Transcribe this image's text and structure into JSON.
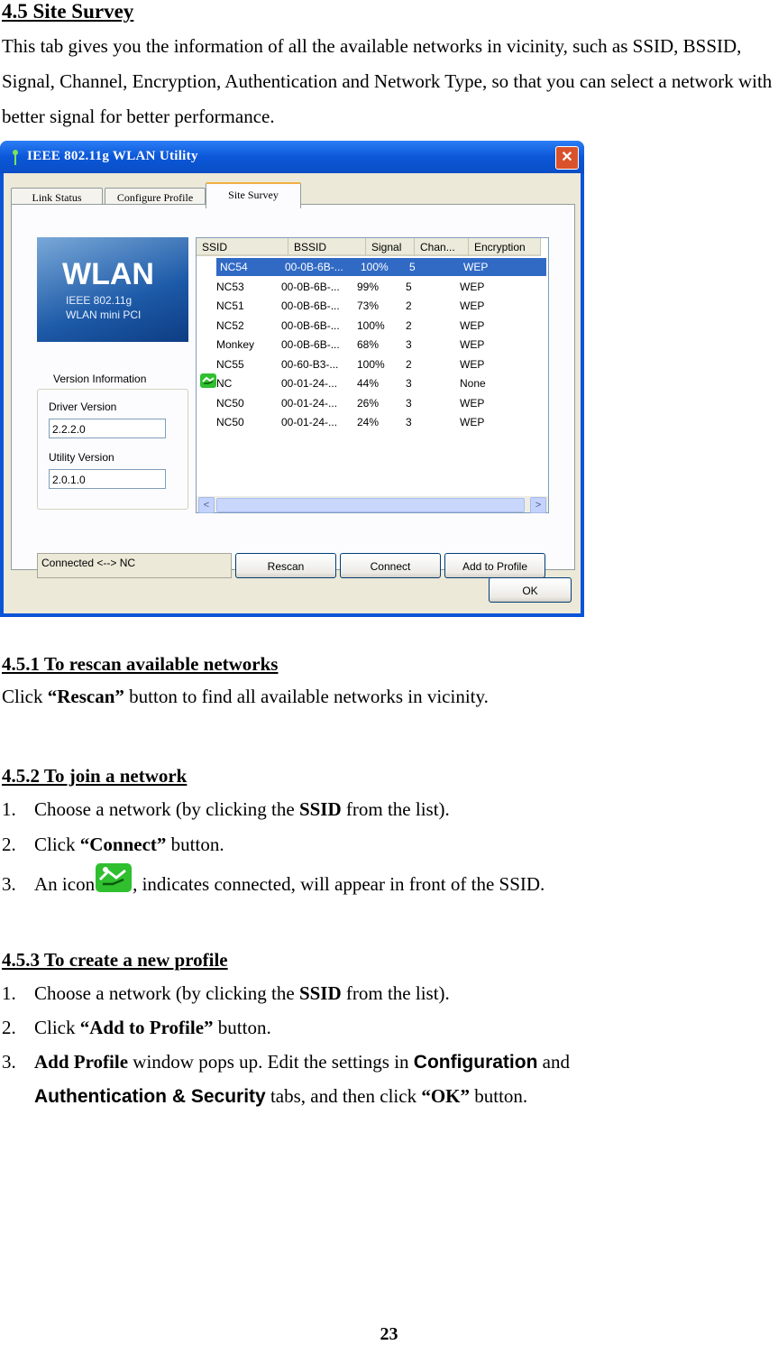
{
  "section": {
    "title": "4.5 Site Survey",
    "intro": "This tab gives you the information of all the available networks in vicinity, such as SSID, BSSID, Signal, Channel, Encryption, Authentication and Network Type, so that you can select a network with better signal for better performance."
  },
  "window": {
    "title": "IEEE 802.11g WLAN Utility",
    "close_glyph": "✕",
    "tabs": [
      "Link Status",
      "Configure Profile",
      "Site Survey"
    ],
    "logo": {
      "big": "WLAN",
      "line1": "IEEE 802.11g",
      "line2": "WLAN mini PCI"
    },
    "version_group": "Version Information",
    "driver_label": "Driver Version",
    "driver_value": "2.2.2.0",
    "utility_label": "Utility Version",
    "utility_value": "2.0.1.0",
    "columns": [
      "SSID",
      "BSSID",
      "Signal",
      "Chan...",
      "Encryption"
    ],
    "rows": [
      {
        "ssid": "NC54",
        "bssid": "00-0B-6B-...",
        "signal": "100%",
        "chan": "5",
        "enc": "WEP"
      },
      {
        "ssid": "NC53",
        "bssid": "00-0B-6B-...",
        "signal": "99%",
        "chan": "5",
        "enc": "WEP"
      },
      {
        "ssid": "NC51",
        "bssid": "00-0B-6B-...",
        "signal": "73%",
        "chan": "2",
        "enc": "WEP"
      },
      {
        "ssid": "NC52",
        "bssid": "00-0B-6B-...",
        "signal": "100%",
        "chan": "2",
        "enc": "WEP"
      },
      {
        "ssid": "Monkey",
        "bssid": "00-0B-6B-...",
        "signal": "68%",
        "chan": "3",
        "enc": "WEP"
      },
      {
        "ssid": "NC55",
        "bssid": "00-60-B3-...",
        "signal": "100%",
        "chan": "2",
        "enc": "WEP"
      },
      {
        "ssid": "NC",
        "bssid": "00-01-24-...",
        "signal": "44%",
        "chan": "3",
        "enc": "None"
      },
      {
        "ssid": "NC50",
        "bssid": "00-01-24-...",
        "signal": "26%",
        "chan": "3",
        "enc": "WEP"
      },
      {
        "ssid": "NC50",
        "bssid": "00-01-24-...",
        "signal": "24%",
        "chan": "3",
        "enc": "WEP"
      }
    ],
    "status": "Connected <--> NC",
    "rescan": "Rescan",
    "connect": "Connect",
    "add_to_profile": "Add to Profile",
    "ok": "OK",
    "scroll_left": "<",
    "scroll_right": ">"
  },
  "s451": {
    "title": "4.5.1 To rescan available networks",
    "pre": "Click ",
    "bold": "“Rescan”",
    "post": " button to find all available networks in vicinity."
  },
  "s452": {
    "title": "4.5.2 To join a network",
    "n1": "1.",
    "l1_pre": "Choose a network (by clicking the ",
    "l1_bold": "SSID",
    "l1_post": " from the list).",
    "n2": "2.",
    "l2_pre": "Click ",
    "l2_bold": "“Connect”",
    "l2_post": " button.",
    "n3": "3.",
    "l3_pre": "An icon",
    "l3_post": ", indicates connected, will appear in front of the SSID."
  },
  "s453": {
    "title": "4.5.3 To create a new profile",
    "n1": "1.",
    "l1_pre": "Choose a network (by clicking the ",
    "l1_bold": "SSID",
    "l1_post": " from the list).",
    "n2": "2.",
    "l2_pre": "Click ",
    "l2_bold": "“Add to Profile”",
    "l2_post": " button.",
    "n3": "3.",
    "l3_bold": "Add Profile",
    "l3_mid": " window pops up.    Edit the settings in ",
    "l3_cfg": "Configuration",
    "l3_and": " and",
    "l4_auth": "Authentication & Security",
    "l4_mid": " tabs, and then click ",
    "l4_ok": "“OK”",
    "l4_post": " button."
  },
  "page_number": "23"
}
